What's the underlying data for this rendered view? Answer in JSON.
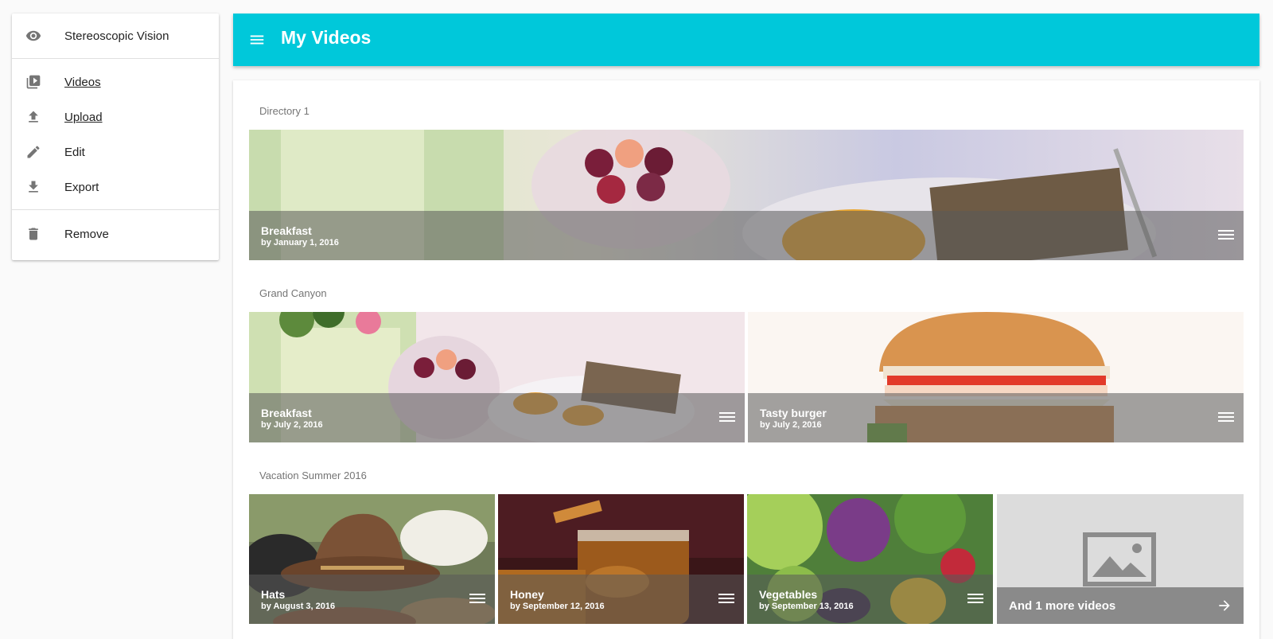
{
  "sidebar": {
    "header": {
      "label": "Stereoscopic Vision",
      "icon": "eye-icon"
    },
    "items": [
      {
        "label": "Videos",
        "icon": "video-library-icon",
        "link": true
      },
      {
        "label": "Upload",
        "icon": "upload-icon",
        "link": true
      },
      {
        "label": "Edit",
        "icon": "pencil-icon",
        "link": false
      },
      {
        "label": "Export",
        "icon": "download-icon",
        "link": false
      }
    ],
    "footer": {
      "label": "Remove",
      "icon": "trash-icon"
    }
  },
  "header": {
    "title": "My Videos",
    "accent": "#00c8da"
  },
  "directories": [
    {
      "name": "Directory 1",
      "videos": [
        {
          "title": "Breakfast",
          "subtitle": "by January 1, 2016"
        }
      ]
    },
    {
      "name": "Grand Canyon",
      "videos": [
        {
          "title": "Breakfast",
          "subtitle": "by July 2, 2016"
        },
        {
          "title": "Tasty burger",
          "subtitle": "by July 2, 2016"
        }
      ]
    },
    {
      "name": "Vacation Summer 2016",
      "videos": [
        {
          "title": "Hats",
          "subtitle": "by August 3, 2016"
        },
        {
          "title": "Honey",
          "subtitle": "by September 12, 2016"
        },
        {
          "title": "Vegetables",
          "subtitle": "by September 13, 2016"
        }
      ],
      "more_label": "And 1 more videos"
    }
  ]
}
